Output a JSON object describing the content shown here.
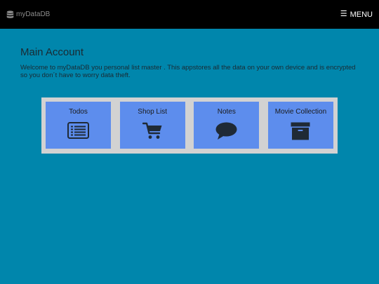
{
  "header": {
    "brand_label": "myDataDB",
    "menu_label": "MENU"
  },
  "main": {
    "title": "Main Account",
    "welcome_text": "Welcome to myDataDB you personal list master . This appstores all the data on your own device and is encrypted so you don´t have to worry data theft."
  },
  "tiles": [
    {
      "label": "Todos",
      "icon": "list-icon"
    },
    {
      "label": "Shop List",
      "icon": "shopping-cart-icon"
    },
    {
      "label": "Notes",
      "icon": "speech-bubble-icon"
    },
    {
      "label": "Movie Collection",
      "icon": "archive-box-icon"
    }
  ],
  "colors": {
    "background": "#0086ac",
    "topbar": "#000000",
    "tile": "#5d8ded",
    "tile_panel": "#d2d2d2",
    "icon": "#1f2a36"
  }
}
